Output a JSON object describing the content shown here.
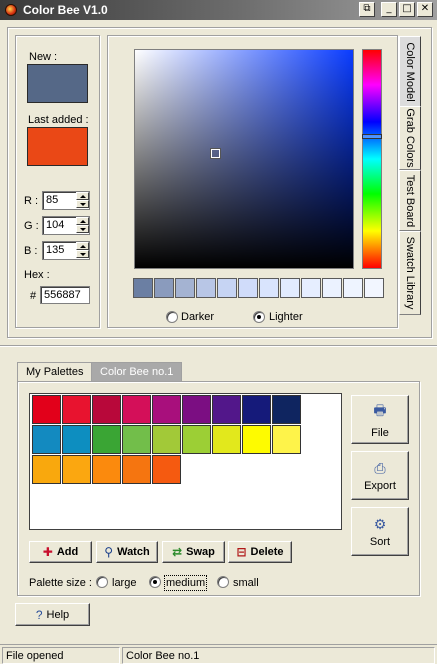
{
  "window": {
    "title": "Color Bee V1.0"
  },
  "left_panel": {
    "new_label": "New :",
    "new_color": "#556887",
    "last_added_label": "Last added :",
    "last_added_color": "#ea4816",
    "r_label": "R :",
    "r_value": "85",
    "g_label": "G :",
    "g_value": "104",
    "b_label": "B :",
    "b_value": "135",
    "hex_label": "Hex :",
    "hash": "#",
    "hex_value": "556887"
  },
  "shades": [
    "#6b7fa3",
    "#8a9bbd",
    "#a4b3d2",
    "#b8c6e6",
    "#c6d4f3",
    "#d0dcfa",
    "#d9e4fd",
    "#e1ebfe",
    "#e6eeff",
    "#ebf2ff",
    "#eef4ff",
    "#f2f6ff"
  ],
  "shade_options": {
    "darker": "Darker",
    "lighter": "Lighter",
    "selected": "lighter"
  },
  "vertical_tabs": [
    "Color Model",
    "Grab Colors",
    "Test Board",
    "Swatch Library"
  ],
  "palette_tabs": [
    "My Palettes",
    "Color Bee no.1"
  ],
  "palette_colors": [
    [
      "#e2001a",
      "#e8132f",
      "#b8083a",
      "#d40f59",
      "#a80f7c",
      "#7b0e82",
      "#52178a",
      "#151a7a",
      "#0f2560"
    ],
    [
      "#138ac0",
      "#0d8ec0",
      "#3aa534",
      "#72be4a",
      "#a2c938",
      "#9ccf35",
      "#e2e81c",
      "#fefb00",
      "#fef34a"
    ],
    [
      "#f9a80d",
      "#fba710",
      "#fb8a0d",
      "#f57510",
      "#f55a10"
    ]
  ],
  "actions": {
    "add": "Add",
    "watch": "Watch",
    "swap": "Swap",
    "delete": "Delete"
  },
  "side_actions": {
    "file": "File",
    "export": "Export",
    "sort": "Sort"
  },
  "palette_size": {
    "label": "Palette size :",
    "large": "large",
    "medium": "medium",
    "small": "small",
    "selected": "medium"
  },
  "help_label": "Help",
  "status": {
    "left": "File opened",
    "right": "Color Bee no.1"
  }
}
